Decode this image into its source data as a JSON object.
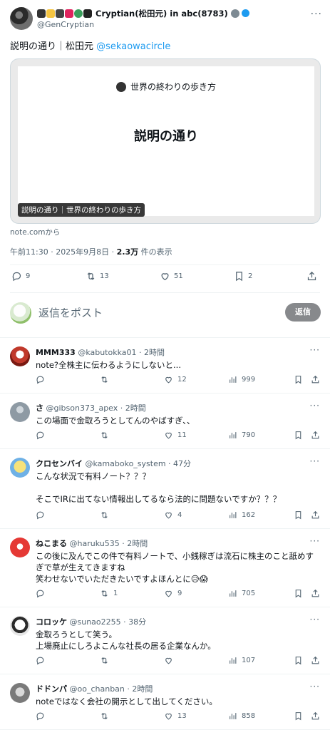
{
  "main_post": {
    "author_name": "Cryptian(松田元) in abc(8783)",
    "handle": "@GenCryptian",
    "text_prefix": "説明の通り｜松田元",
    "text_mention": "@sekaowacircle",
    "card": {
      "blog_name": "世界の終わりの歩き方",
      "title": "説明の通り",
      "caption": "説明の通り｜世界の終わりの歩き方"
    },
    "source": "note.comから",
    "time": "午前11:30 · 2025年9月8日 · ",
    "views": "2.3万",
    "views_suffix": " 件の表示",
    "stats": {
      "replies": "9",
      "reposts": "13",
      "likes": "51",
      "bookmarks": "2"
    }
  },
  "reply_box": {
    "placeholder": "返信をポスト",
    "button": "返信"
  },
  "replies": [
    {
      "name": "MMM333",
      "meta": "@kabutokka01 · 2時間",
      "lines": [
        "note?全株主に伝わるようにしないと..."
      ],
      "reposts": "",
      "likes": "12",
      "views": "999"
    },
    {
      "name": "さ",
      "meta": "@gibson373_apex · 2時間",
      "lines": [
        "この場面で金取ろうとしてんのやばすぎ、、"
      ],
      "reposts": "",
      "likes": "11",
      "views": "790"
    },
    {
      "name": "クロセンバイ",
      "meta": "@kamaboko_system · 47分",
      "lines": [
        "こんな状況で有料ノート？？？",
        "",
        "そこでIRに出てない情報出してるなら法的に問題ないですか？？？"
      ],
      "reposts": "",
      "likes": "4",
      "views": "162"
    },
    {
      "name": "ねこまる",
      "meta": "@haruku535 · 2時間",
      "lines": [
        "この後に及んでこの件で有料ノートで、小銭稼ぎは流石に株主のこと舐めす",
        "ぎで草が生えてきますね",
        "笑わせないでいただきたいですよほんとに😥😱"
      ],
      "reposts": "1",
      "likes": "9",
      "views": "705"
    },
    {
      "name": "コロッケ",
      "meta": "@sunao2255 · 38分",
      "lines": [
        "金取ろうとして笑う。",
        "上場廃止にしろよこんな社長の居る企業なんか。"
      ],
      "reposts": "",
      "likes": "",
      "views": "107"
    },
    {
      "name": "ドドンパ",
      "meta": "@oo_chanban · 2時間",
      "lines": [
        "noteではなく会社の開示として出してください。"
      ],
      "reposts": "",
      "likes": "13",
      "views": "858"
    }
  ],
  "colors": {
    "accent": "#1d9bf0",
    "muted": "#536471",
    "reply_button": "#87898c"
  }
}
